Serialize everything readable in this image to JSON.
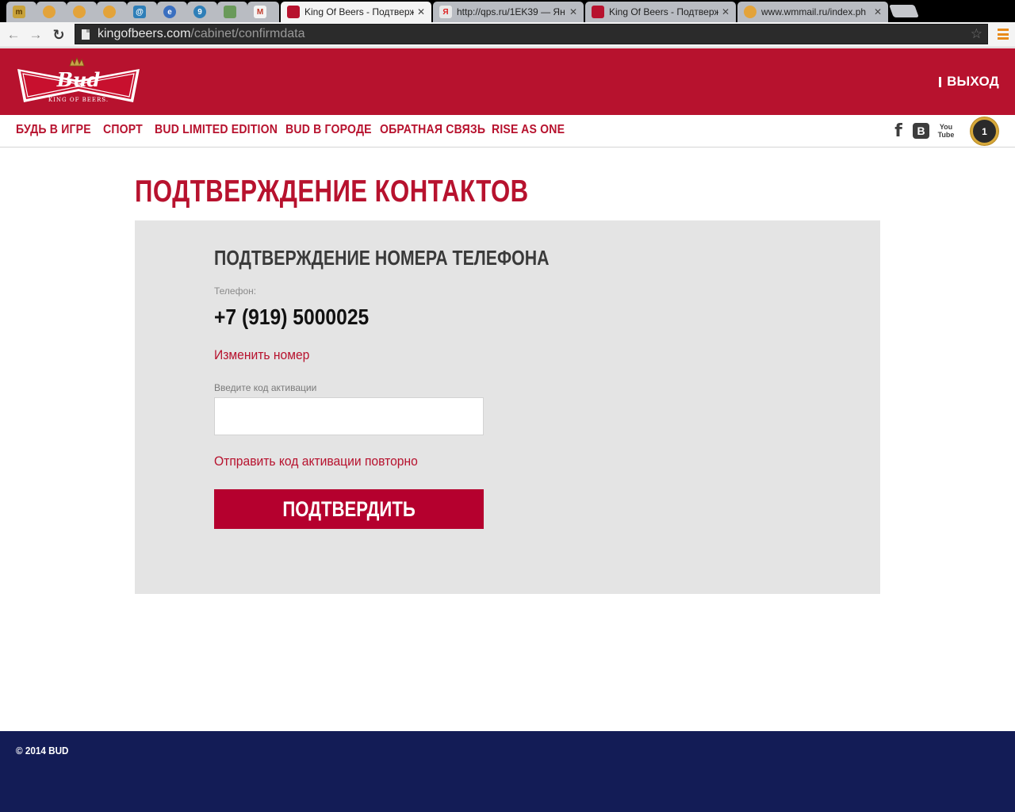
{
  "browser": {
    "tabs": [
      {
        "title": "",
        "favicon": "m-favicon",
        "favicon_text": "m",
        "favicon_color": "#c8a23a",
        "active": false
      },
      {
        "title": "",
        "favicon": "coin-favicon",
        "favicon_text": "",
        "favicon_color": "#e3a33a",
        "active": false
      },
      {
        "title": "",
        "favicon": "coin-favicon",
        "favicon_text": "",
        "favicon_color": "#e3a33a",
        "active": false
      },
      {
        "title": "",
        "favicon": "coin-favicon",
        "favicon_text": "",
        "favicon_color": "#e3a33a",
        "active": false
      },
      {
        "title": "",
        "favicon": "at-favicon",
        "favicon_text": "@",
        "favicon_color": "#2f7fb8",
        "active": false
      },
      {
        "title": "",
        "favicon": "globe-favicon",
        "favicon_text": "e",
        "favicon_color": "#3a6fc0",
        "active": false
      },
      {
        "title": "",
        "favicon": "pin-favicon",
        "favicon_text": "9",
        "favicon_color": "#2f7fb8",
        "active": false
      },
      {
        "title": "",
        "favicon": "image-favicon",
        "favicon_text": "",
        "favicon_color": "#6a9a5a",
        "active": false
      },
      {
        "title": "",
        "favicon": "gmail-favicon",
        "favicon_text": "M",
        "favicon_color": "#c23a2a",
        "active": false
      },
      {
        "title": "King Of Beers - Подтверж",
        "favicon": "bud-favicon",
        "favicon_text": "",
        "favicon_color": "#b7122e",
        "active": true
      },
      {
        "title": "http://qps.ru/1EK39 — Ян",
        "favicon": "yandex-favicon",
        "favicon_text": "Я",
        "favicon_color": "#e8e8e8",
        "active": false
      },
      {
        "title": "King Of Beers - Подтверж",
        "favicon": "bud-favicon",
        "favicon_text": "",
        "favicon_color": "#b7122e",
        "active": false
      },
      {
        "title": "www.wmmail.ru/index.ph",
        "favicon": "coin-favicon",
        "favicon_text": "",
        "favicon_color": "#e3a33a",
        "active": false
      }
    ],
    "url_host": "kingofbeers.com",
    "url_path": "/cabinet/confirmdata"
  },
  "header": {
    "logo_text": "Bud",
    "logo_tagline": "KING OF BEERS.",
    "logout_label": "ВЫХОД"
  },
  "nav": {
    "items": [
      {
        "label": "БУДЬ В ИГРЕ"
      },
      {
        "label": "СПОРТ"
      },
      {
        "label": "BUD LIMITED EDITION"
      },
      {
        "label": "BUD В ГОРОДЕ"
      },
      {
        "label": "ОБРАТНАЯ СВЯЗЬ"
      },
      {
        "label": "RISE AS ONE"
      }
    ],
    "social": {
      "facebook": "f",
      "vk": "B",
      "youtube_top": "You",
      "youtube_bottom": "Tube"
    },
    "badge_count": "1"
  },
  "main": {
    "page_title": "ПОДТВЕРЖДЕНИЕ КОНТАКТОВ",
    "panel_title": "ПОДТВЕРЖДЕНИЕ НОМЕРА ТЕЛЕФОНА",
    "phone_label": "Телефон:",
    "phone_value": "+7 (919) 5000025",
    "change_number_label": "Изменить номер",
    "code_label": "Введите код активации",
    "code_value": "",
    "code_placeholder": "",
    "resend_label": "Отправить код активации повторно",
    "confirm_label": "ПОДТВЕРДИТЬ"
  },
  "footer": {
    "copyright": "© 2014 BUD"
  },
  "colors": {
    "brand_red": "#b7122e",
    "button_red": "#b5002e",
    "panel_gray": "#e4e4e4",
    "footer_navy": "#131c56"
  }
}
